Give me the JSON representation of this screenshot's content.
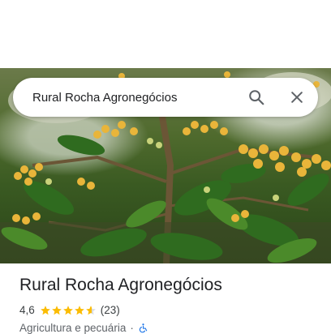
{
  "search": {
    "query": "Rural Rocha Agronegócios",
    "search_icon": "search-icon",
    "close_icon": "close-icon"
  },
  "place": {
    "name": "Rural Rocha Agronegócios",
    "rating": "4,6",
    "rating_stars": 4.6,
    "review_count": "(23)",
    "category": "Agricultura e pecuária",
    "separator": "·",
    "accessibility_icon": "wheelchair-icon"
  },
  "colors": {
    "star": "#fbbc04",
    "accessibility": "#1a73e8",
    "title": "#202124",
    "secondary": "#5f6368"
  }
}
